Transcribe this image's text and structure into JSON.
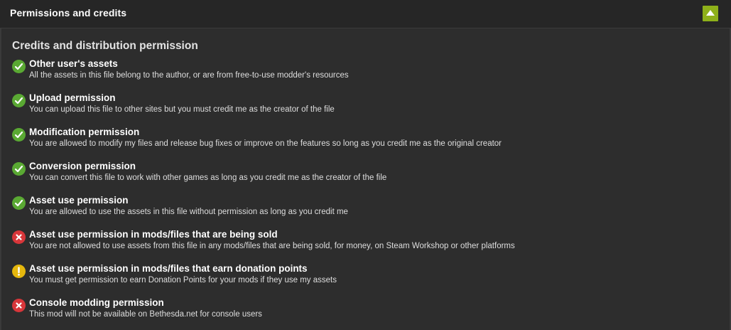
{
  "header": {
    "title": "Permissions and credits",
    "collapse_icon": "chevron-up-icon",
    "accent_color": "#8eb01a"
  },
  "section": {
    "title": "Credits and distribution permission"
  },
  "status_colors": {
    "ok": "#5aa933",
    "no": "#d8363a",
    "warn": "#e5b70d"
  },
  "permissions": [
    {
      "status": "ok",
      "icon": "check-icon",
      "title": "Other user's assets",
      "description": "All the assets in this file belong to the author, or are from free-to-use modder's resources"
    },
    {
      "status": "ok",
      "icon": "check-icon",
      "title": "Upload permission",
      "description": "You can upload this file to other sites but you must credit me as the creator of the file"
    },
    {
      "status": "ok",
      "icon": "check-icon",
      "title": "Modification permission",
      "description": "You are allowed to modify my files and release bug fixes or improve on the features so long as you credit me as the original creator"
    },
    {
      "status": "ok",
      "icon": "check-icon",
      "title": "Conversion permission",
      "description": "You can convert this file to work with other games as long as you credit me as the creator of the file"
    },
    {
      "status": "ok",
      "icon": "check-icon",
      "title": "Asset use permission",
      "description": "You are allowed to use the assets in this file without permission as long as you credit me"
    },
    {
      "status": "no",
      "icon": "cross-icon",
      "title": "Asset use permission in mods/files that are being sold",
      "description": "You are not allowed to use assets from this file in any mods/files that are being sold, for money, on Steam Workshop or other platforms"
    },
    {
      "status": "warn",
      "icon": "exclamation-icon",
      "title": "Asset use permission in mods/files that earn donation points",
      "description": "You must get permission to earn Donation Points for your mods if they use my assets"
    },
    {
      "status": "no",
      "icon": "cross-icon",
      "title": "Console modding permission",
      "description": "This mod will not be available on Bethesda.net for console users"
    }
  ]
}
